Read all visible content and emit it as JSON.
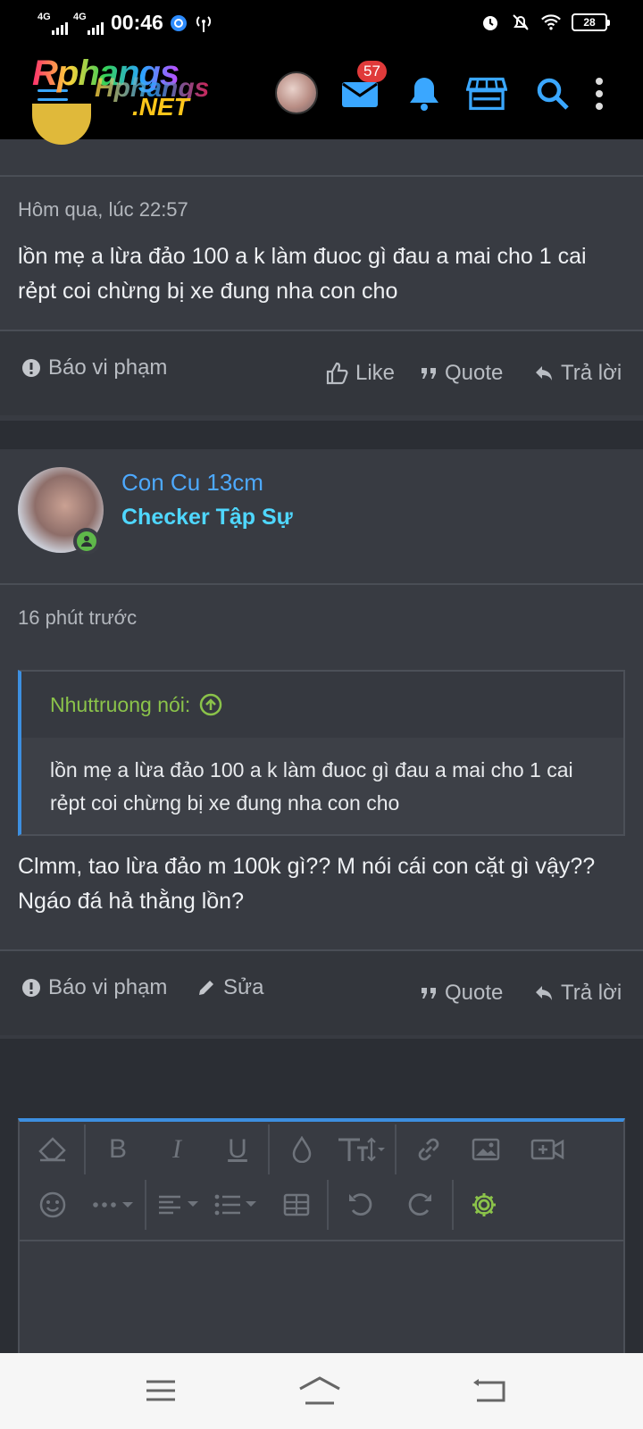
{
  "status_bar": {
    "network1": "4G",
    "network2": "4G",
    "time": "00:46",
    "battery": "28"
  },
  "header": {
    "logo_line1": "Rphangs",
    "logo_line2": "Hphangs",
    "logo_line3": ".NET",
    "message_badge": "57"
  },
  "post1": {
    "timestamp": "Hôm qua, lúc 22:57",
    "body": "lồn mẹ a lừa đảo 100 a k làm đuoc gì đau a mai cho 1 cai rẻpt coi chừng bị xe đung nha con cho",
    "report_label": "Báo vi phạm",
    "like_label": "Like",
    "quote_label": "Quote",
    "reply_label": "Trả lời"
  },
  "post2": {
    "username": "Con Cu 13cm",
    "user_title": "Checker Tập Sự",
    "timestamp": "16 phút trước",
    "quote_author": "Nhuttruong nói:",
    "quote_body": "lồn mẹ a lừa đảo 100 a k làm đuoc gì đau a mai cho 1 cai rẻpt coi chừng bị xe đung nha con cho",
    "body": "Clmm, tao lừa đảo m 100k gì?? M nói cái con cặt gì vậy?? Ngáo đá hả thằng lồn?",
    "report_label": "Báo vi phạm",
    "edit_label": "Sửa",
    "quote_label": "Quote",
    "reply_label": "Trả lời"
  },
  "editor": {
    "bold": "B",
    "italic": "I",
    "underline": "U"
  },
  "colors": {
    "accent": "#3d8fe0",
    "username": "#4da9ff",
    "user_title": "#4fd7ff",
    "quote_author": "#8bc34a",
    "badge": "#e03a3a"
  }
}
